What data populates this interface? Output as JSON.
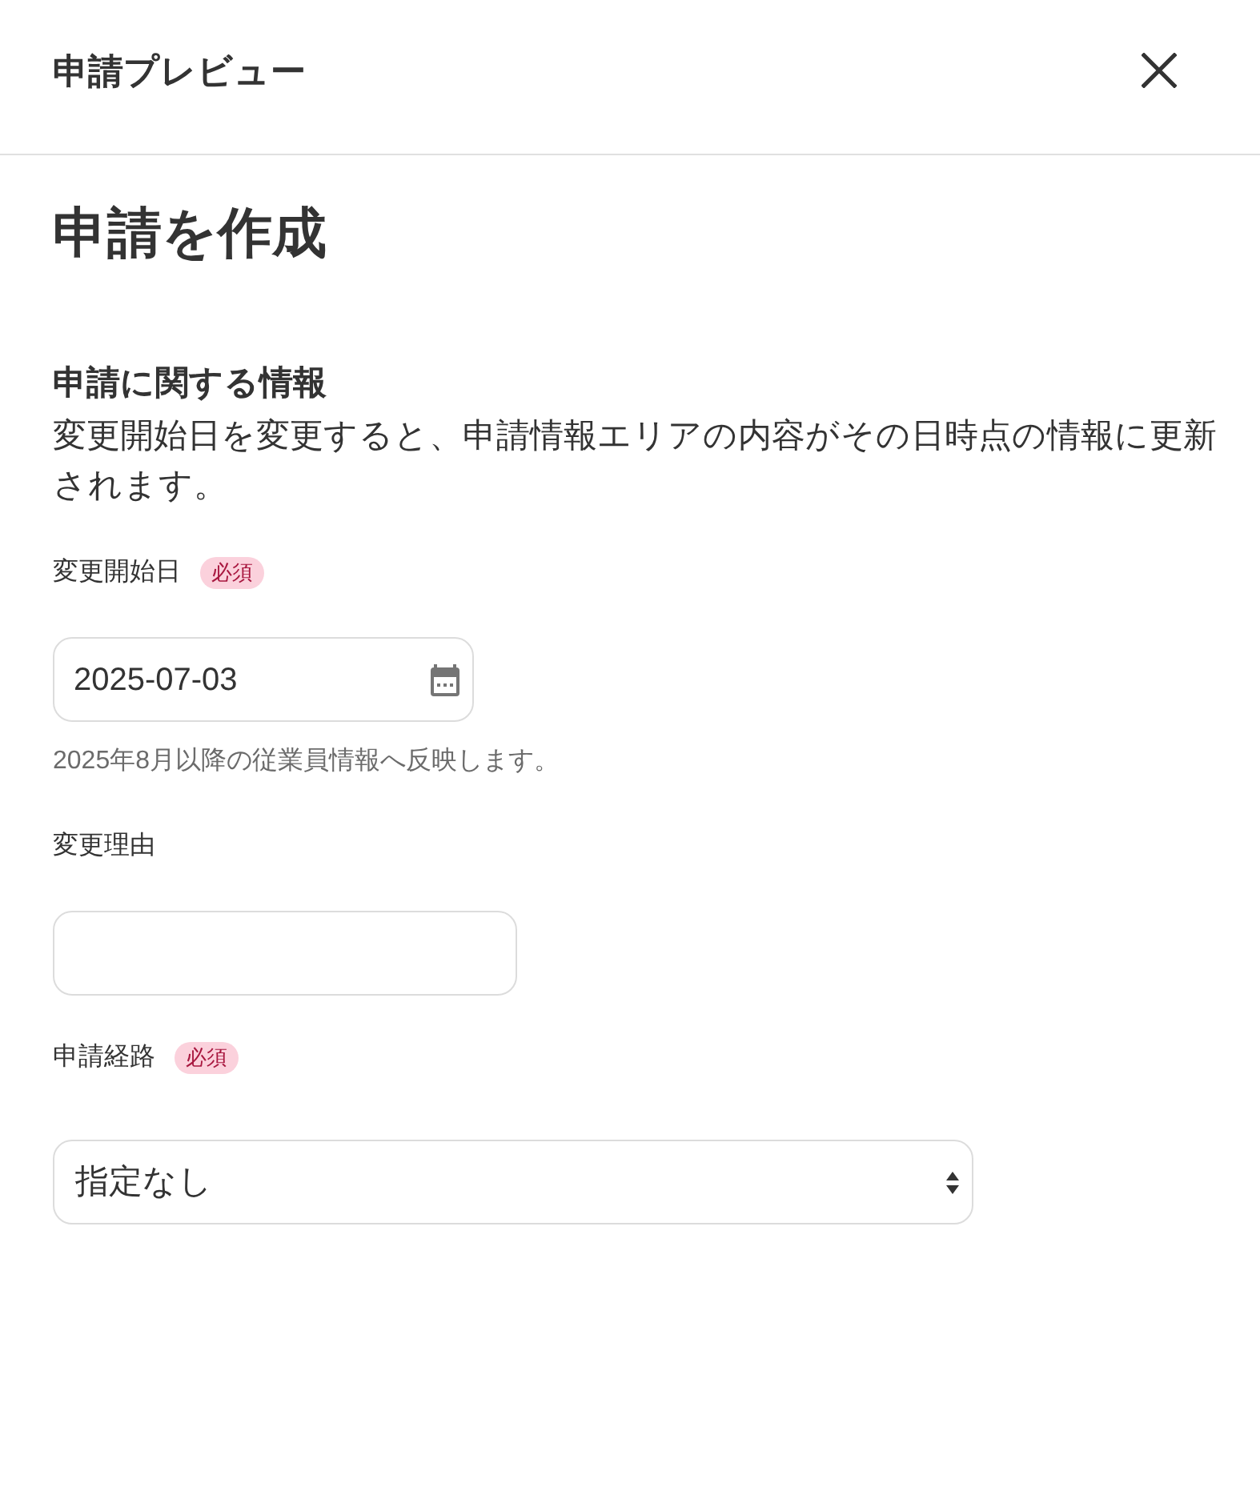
{
  "header": {
    "title": "申請プレビュー"
  },
  "page": {
    "title": "申請を作成"
  },
  "section": {
    "heading": "申請に関する情報",
    "description": "変更開始日を変更すると、申請情報エリアの内容がその日時点の情報に更新されます。"
  },
  "fields": [
    {
      "kind": "date",
      "label": "変更開始日",
      "badge": "必須",
      "value": "2025-07-03",
      "help": "2025年8月以降の従業員情報へ反映します。"
    },
    {
      "kind": "text",
      "label": "変更理由"
    },
    {
      "kind": "select",
      "label": "申請経路",
      "badge": "必須",
      "value": "指定なし"
    }
  ]
}
